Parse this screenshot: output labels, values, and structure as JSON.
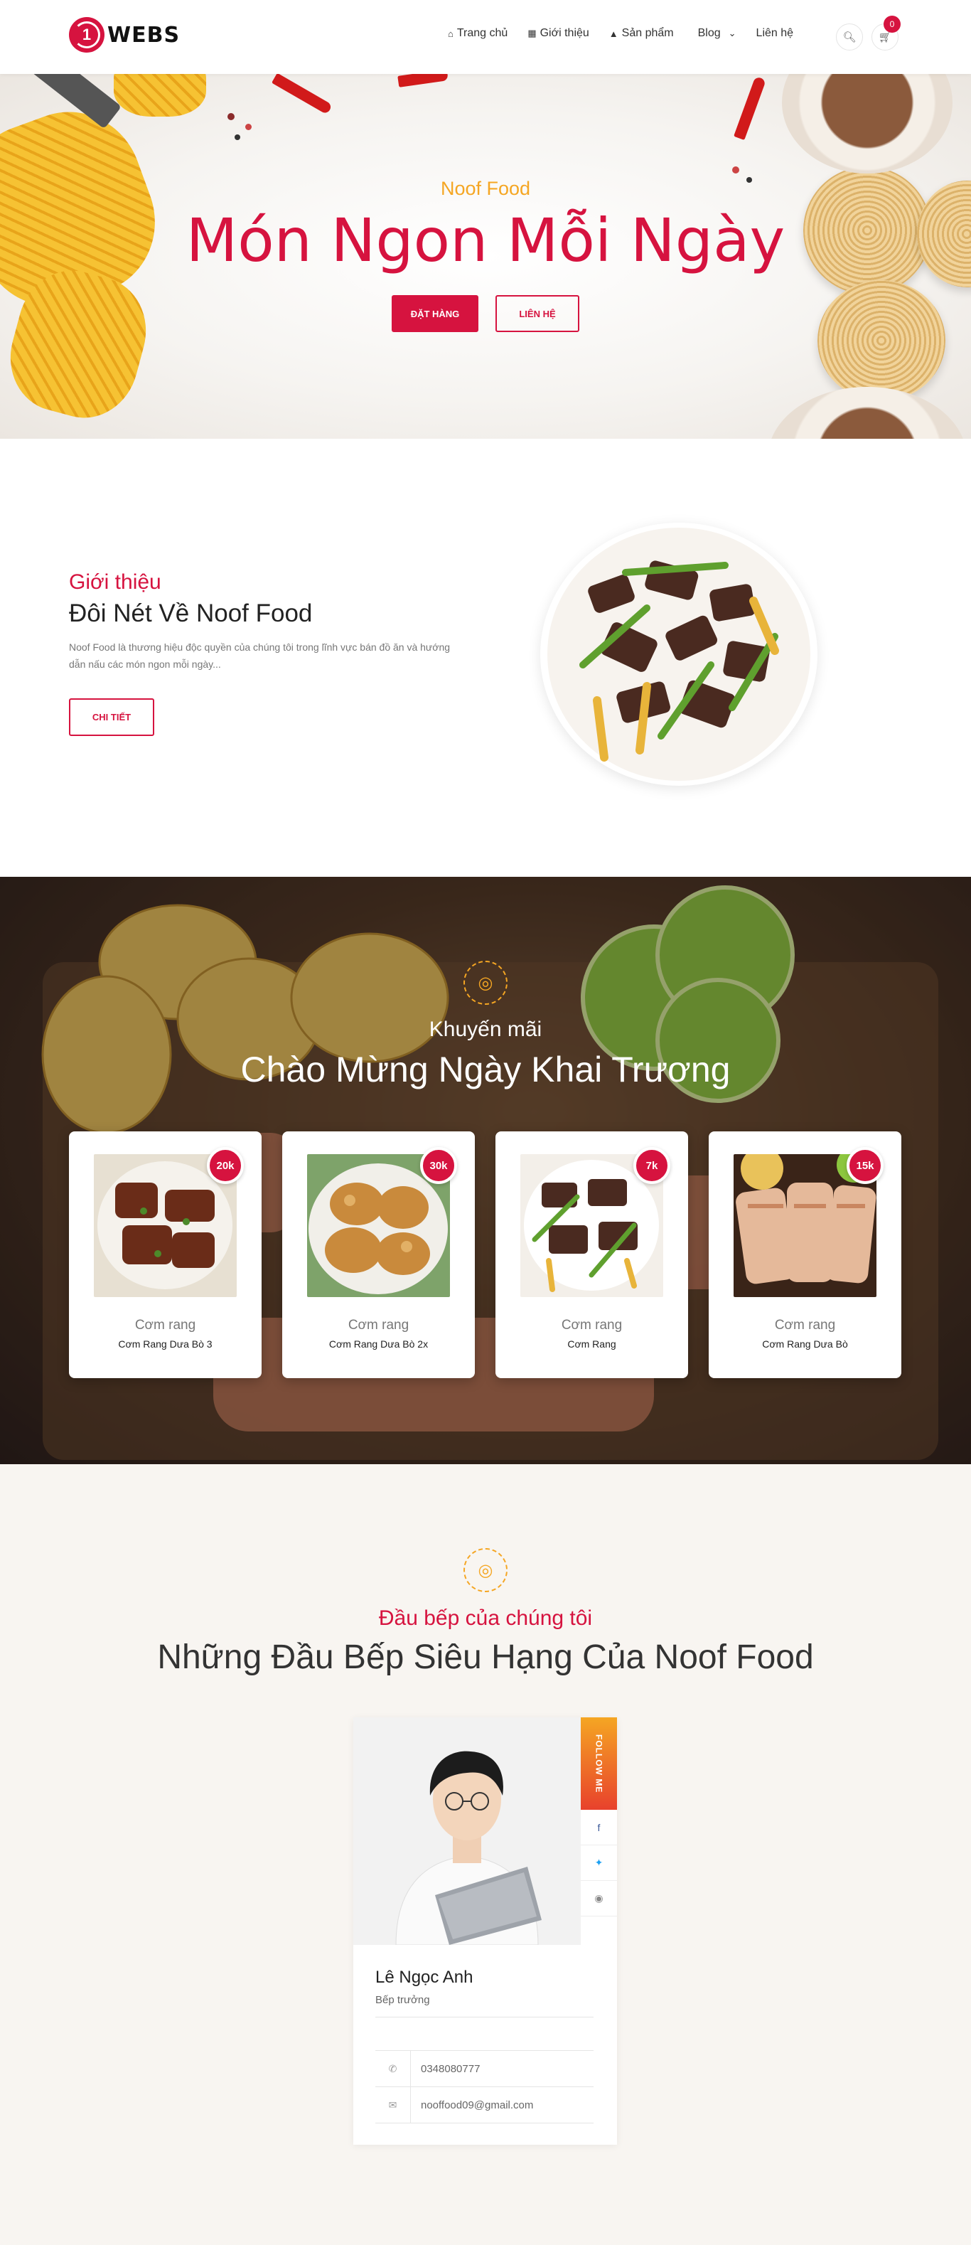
{
  "header": {
    "logo_mark": "1",
    "logo_text": "WEBS",
    "nav": [
      {
        "icon": "⌂",
        "label": "Trang chủ"
      },
      {
        "icon": "▦",
        "label": "Giới thiệu"
      },
      {
        "icon": "▲",
        "label": "Sản phẩm"
      },
      {
        "icon": "",
        "label": "Blog"
      },
      {
        "icon": "",
        "label": "Liên hệ"
      }
    ],
    "blog_caret": "⌄",
    "cart_count": "0"
  },
  "hero": {
    "subtitle": "Noof Food",
    "title": "Món Ngon Mỗi Ngày",
    "order_label": "ĐẶT HÀNG",
    "contact_label": "LIÊN HỆ"
  },
  "about": {
    "subtitle": "Giới thiệu",
    "title": "Đôi Nét Về Noof Food",
    "description": "Noof Food là thương hiệu độc quyền của chúng tôi trong lĩnh vực bán đồ ăn và hướng dẫn nấu các món ngon mỗi ngày...",
    "detail_label": "CHI TIẾT"
  },
  "promo": {
    "subtitle": "Khuyến mãi",
    "title": "Chào Mừng Ngày Khai Trương",
    "items": [
      {
        "price": "20k",
        "category": "Cơm rang",
        "name": "Cơm Rang Dưa Bò 3"
      },
      {
        "price": "30k",
        "category": "Cơm rang",
        "name": "Cơm Rang Dưa Bò 2x"
      },
      {
        "price": "7k",
        "category": "Cơm rang",
        "name": "Cơm Rang"
      },
      {
        "price": "15k",
        "category": "Cơm rang",
        "name": "Cơm Rang Dưa Bò"
      }
    ]
  },
  "chefs": {
    "subtitle": "Đầu bếp của chúng tôi",
    "title": "Những Đầu Bếp Siêu Hạng Của Noof Food",
    "follow_label": "FOLLOW ME",
    "chef": {
      "name": "Lê Ngọc Anh",
      "role": "Bếp trưởng",
      "phone": "0348080777",
      "email": "nooffood09@gmail.com"
    }
  },
  "colors": {
    "accent": "#d6133f",
    "gold": "#f5a623"
  }
}
